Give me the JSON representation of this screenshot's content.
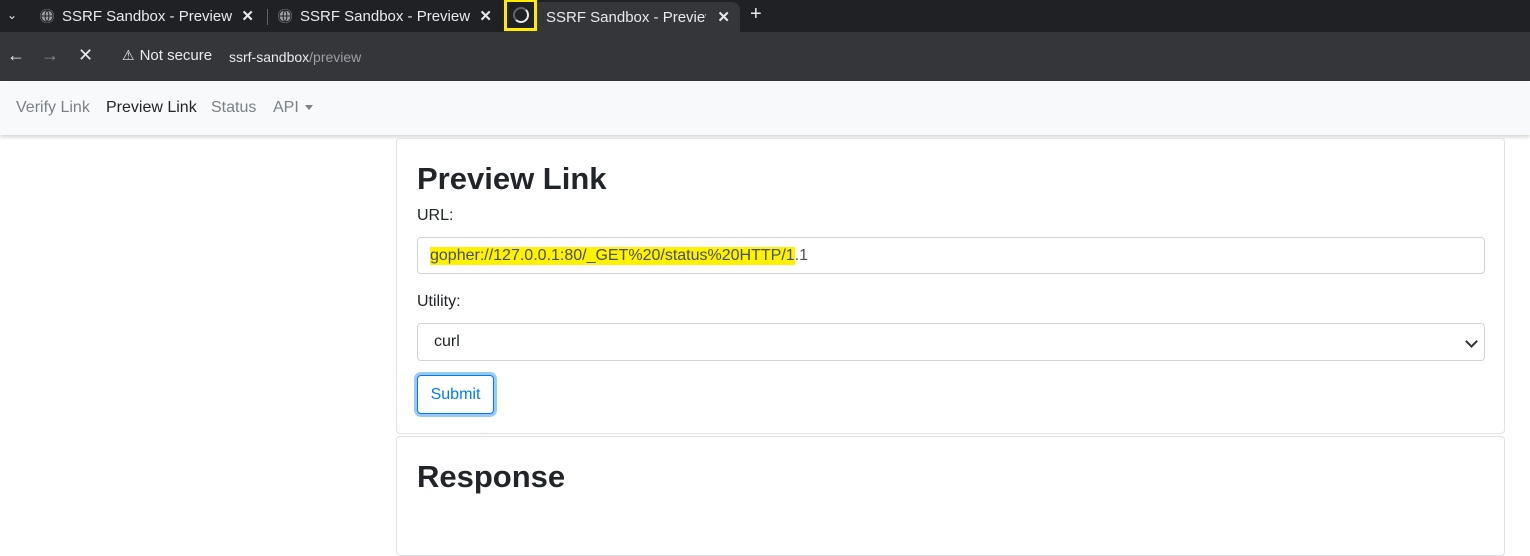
{
  "browser": {
    "tabs": [
      {
        "title": "SSRF Sandbox - Preview Link"
      },
      {
        "title": "SSRF Sandbox - Preview Link"
      },
      {
        "title": "SSRF Sandbox - Preview Link"
      }
    ],
    "security_label": "Not secure",
    "url_host": "ssrf-sandbox",
    "url_path": "/preview"
  },
  "nav": {
    "items": [
      {
        "label": "Verify Link"
      },
      {
        "label": "Preview Link"
      },
      {
        "label": "Status"
      },
      {
        "label": "API"
      }
    ]
  },
  "form": {
    "heading": "Preview Link",
    "url_label": "URL:",
    "url_value_highlighted": "gopher://127.0.0.1:80/_GET%20/status%20HTTP/1",
    "url_value_rest": ".1",
    "utility_label": "Utility:",
    "utility_value": "curl",
    "submit_label": "Submit"
  },
  "response": {
    "heading": "Response"
  },
  "colors": {
    "highlight": "#fff200",
    "annotation_box": "#ffea00",
    "primary": "#007bff"
  }
}
